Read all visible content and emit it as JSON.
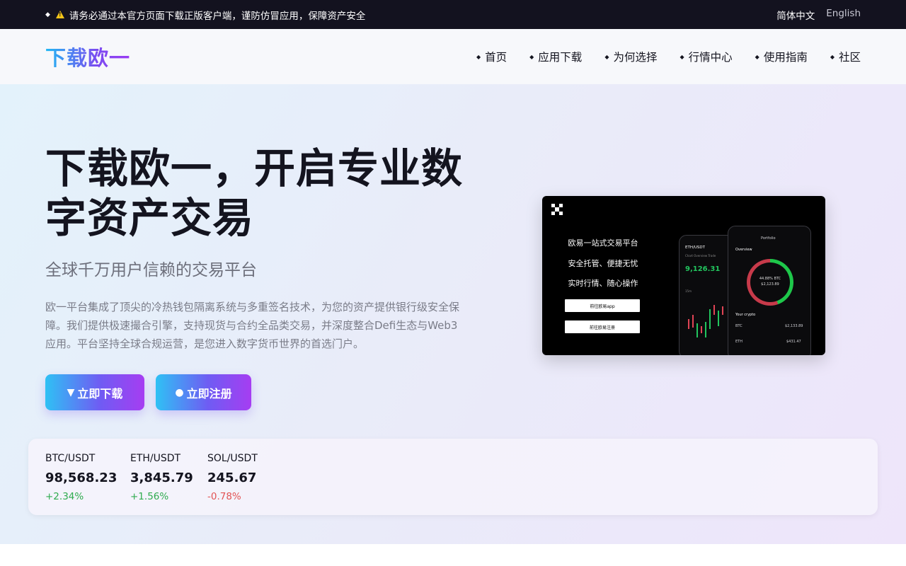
{
  "topbar": {
    "notice": "请务必通过本官方页面下载正版客户端，谨防仿冒应用，保障资产安全",
    "lang_zh": "简体中文",
    "lang_en": "English"
  },
  "header": {
    "logo": "下载欧一",
    "nav": [
      {
        "label": "首页"
      },
      {
        "label": "应用下载"
      },
      {
        "label": "为何选择"
      },
      {
        "label": "行情中心"
      },
      {
        "label": "使用指南"
      },
      {
        "label": "社区"
      }
    ]
  },
  "hero": {
    "title": "下载欧一，开启专业数字资产交易",
    "subtitle": "全球千万用户信赖的交易平台",
    "description": "欧一平台集成了顶尖的冷热钱包隔离系统与多重签名技术，为您的资产提供银行级安全保障。我们提供极速撮合引擎，支持现货与合约全品类交易，并深度整合Defi生态与Web3应用。平台坚持全球合规运营，是您进入数字货币世界的首选门户。",
    "download_button": "立即下载",
    "register_button": "立即注册",
    "download_symbol": "▼",
    "register_symbol": "●"
  },
  "promo": {
    "line1": "欧易一站式交易平台",
    "line2": "安全托管、便捷无忧",
    "line3": "实时行情、随心操作",
    "button1": "前往欧易app",
    "button2": "前往欧易注册",
    "left_phone": {
      "pair": "ETH/USDT",
      "tabs": "Chart   Overview   Trade",
      "price": "9,126.31",
      "interval": "15m"
    },
    "right_phone": {
      "header": "Portfolio",
      "overview": "Overview",
      "donut_pct": "44.88% BTC",
      "donut_val": "$2,123.89",
      "your_crypto": "Your crypto",
      "row1_sym": "BTC",
      "row1_val": "$2,133.89",
      "row2_sym": "ETH",
      "row2_val": "$431.47"
    }
  },
  "ticker": [
    {
      "pair": "BTC/USDT",
      "price": "98,568.23",
      "change": "+2.34%",
      "direction": "up"
    },
    {
      "pair": "ETH/USDT",
      "price": "3,845.79",
      "change": "+1.56%",
      "direction": "up"
    },
    {
      "pair": "SOL/USDT",
      "price": "245.67",
      "change": "-0.78%",
      "direction": "down"
    }
  ],
  "colors": {
    "topbar_bg": "#13121f",
    "accent_start": "#2fc1f4",
    "accent_end": "#a63df2",
    "up": "#2fab4f",
    "down": "#e25454"
  }
}
